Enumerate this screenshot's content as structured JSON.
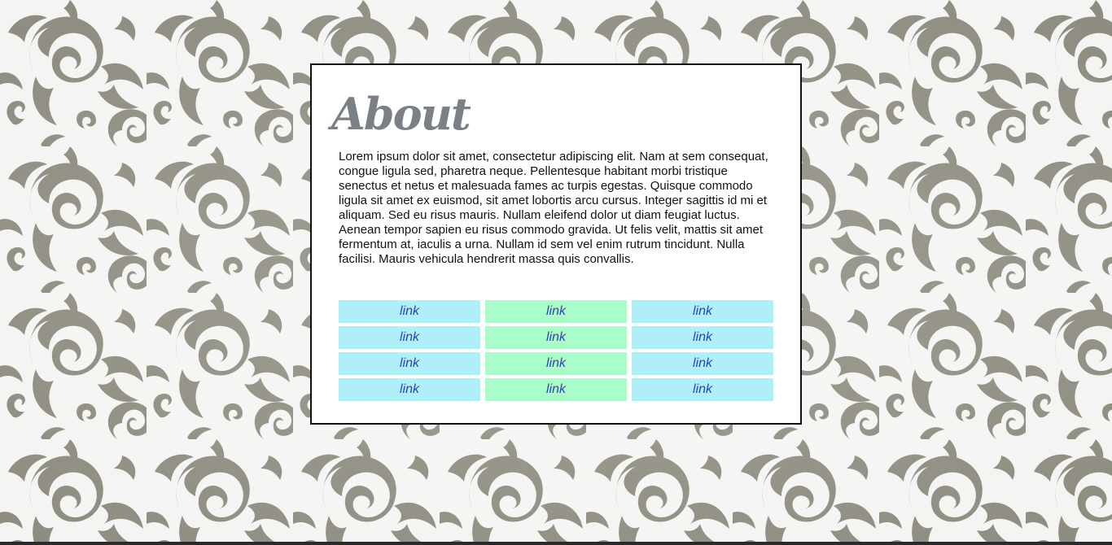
{
  "colors": {
    "page_background": "#f4f4f2",
    "pattern": "#8e8c80",
    "card_background": "#ffffff",
    "card_border": "#111111",
    "title": "#7b7f86",
    "link_text": "#3344aa",
    "link_cell_blue": "#aeeffa",
    "link_cell_green": "#aafdc8"
  },
  "about": {
    "title": "About",
    "paragraph": "Lorem ipsum dolor sit amet, consectetur adipiscing elit. Nam at sem consequat, congue ligula sed, pharetra neque. Pellentesque habitant morbi tristique senectus et netus et malesuada fames ac turpis egestas. Quisque commodo ligula sit amet ex euismod, sit amet lobortis arcu cursus. Integer sagittis id mi et aliquam. Sed eu risus mauris. Nullam eleifend dolor ut diam feugiat luctus. Aenean tempor sapien eu risus commodo gravida. Ut felis velit, mattis sit amet fermentum at, iaculis a urna. Nullam id sem vel enim rutrum tincidunt. Nulla facilisi. Mauris vehicula hendrerit massa quis convallis."
  },
  "links": {
    "rows": [
      [
        "link",
        "link",
        "link"
      ],
      [
        "link",
        "link",
        "link"
      ],
      [
        "link",
        "link",
        "link"
      ],
      [
        "link",
        "link",
        "link"
      ]
    ]
  }
}
